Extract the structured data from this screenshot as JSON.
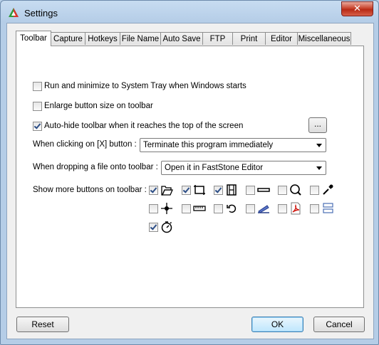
{
  "window": {
    "title": "Settings",
    "close_label": "✕"
  },
  "tabs": [
    {
      "label": "Toolbar"
    },
    {
      "label": "Capture"
    },
    {
      "label": "Hotkeys"
    },
    {
      "label": "File Name"
    },
    {
      "label": "Auto Save"
    },
    {
      "label": "FTP"
    },
    {
      "label": "Print"
    },
    {
      "label": "Editor"
    },
    {
      "label": "Miscellaneous"
    }
  ],
  "options": {
    "tray": {
      "label": "Run and minimize to System Tray when Windows starts",
      "checked": false
    },
    "enlarge": {
      "label": "Enlarge button size on toolbar",
      "checked": false
    },
    "autohide": {
      "label": "Auto-hide toolbar when it reaches the top of the screen",
      "checked": true
    },
    "dots_label": "..."
  },
  "close_action": {
    "label": "When clicking on [X] button :",
    "value": "Terminate this program immediately"
  },
  "drop_action": {
    "label": "When dropping a file onto toolbar :",
    "value": "Open it in FastStone Editor"
  },
  "more_buttons": {
    "label": "Show more buttons on toolbar :",
    "items": [
      {
        "icon": "open-folder-icon",
        "checked": true
      },
      {
        "icon": "crop-region-icon",
        "checked": true
      },
      {
        "icon": "film-strip-icon",
        "checked": true
      },
      {
        "icon": "minimize-bar-icon",
        "checked": false
      },
      {
        "icon": "magnifier-icon",
        "checked": false
      },
      {
        "icon": "color-picker-icon",
        "checked": false
      },
      {
        "icon": "crosshair-icon",
        "checked": false
      },
      {
        "icon": "ruler-icon",
        "checked": false
      },
      {
        "icon": "undo-arrow-icon",
        "checked": false
      },
      {
        "icon": "scanner-icon",
        "checked": false
      },
      {
        "icon": "pdf-icon",
        "checked": false
      },
      {
        "icon": "window-stack-icon",
        "checked": false
      },
      {
        "icon": "timer-icon",
        "checked": true
      }
    ]
  },
  "footer": {
    "reset": "Reset",
    "ok": "OK",
    "cancel": "Cancel"
  }
}
